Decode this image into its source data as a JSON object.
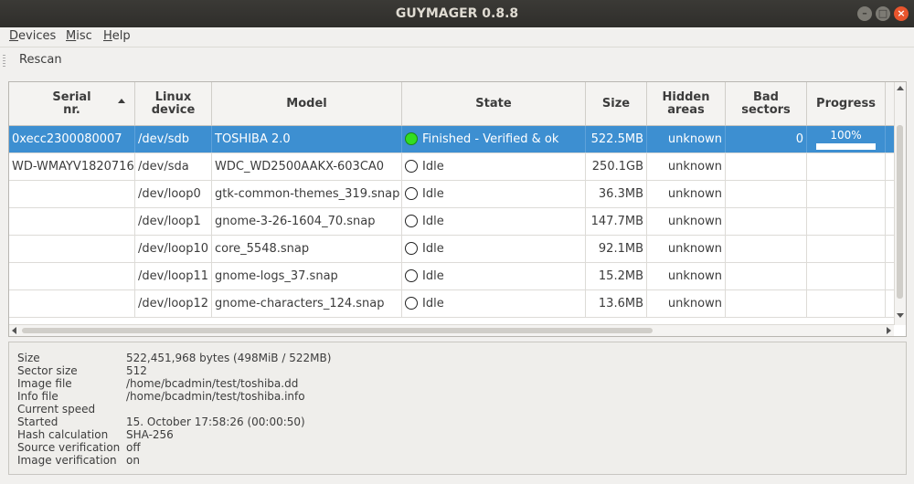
{
  "window": {
    "title": "GUYMAGER 0.8.8"
  },
  "menu": {
    "items": [
      {
        "label": "Devices",
        "ul": "D",
        "rest": "evices"
      },
      {
        "label": "Misc",
        "ul": "M",
        "rest": "isc"
      },
      {
        "label": "Help",
        "ul": "H",
        "rest": "elp"
      }
    ]
  },
  "toolbar": {
    "rescan_label": "Rescan"
  },
  "table": {
    "headers": [
      "Serial\nnr.",
      "Linux\ndevice",
      "Model",
      "State",
      "Size",
      "Hidden\nareas",
      "Bad\nsectors",
      "Progress"
    ],
    "rows": [
      {
        "serial": "0xecc2300080007",
        "device": "/dev/sdb",
        "model": "TOSHIBA 2.0",
        "state": "Finished - Verified & ok",
        "size": "522.5MB",
        "hidden": "unknown",
        "bad": "0",
        "progress": "100%"
      },
      {
        "serial": "WD-WMAYV1820716",
        "device": "/dev/sda",
        "model": "WDC_WD2500AAKX-603CA0",
        "state": "Idle",
        "size": "250.1GB",
        "hidden": "unknown",
        "bad": "",
        "progress": ""
      },
      {
        "serial": "",
        "device": "/dev/loop0",
        "model": "gtk-common-themes_319.snap",
        "state": "Idle",
        "size": "36.3MB",
        "hidden": "unknown",
        "bad": "",
        "progress": ""
      },
      {
        "serial": "",
        "device": "/dev/loop1",
        "model": "gnome-3-26-1604_70.snap",
        "state": "Idle",
        "size": "147.7MB",
        "hidden": "unknown",
        "bad": "",
        "progress": ""
      },
      {
        "serial": "",
        "device": "/dev/loop10",
        "model": "core_5548.snap",
        "state": "Idle",
        "size": "92.1MB",
        "hidden": "unknown",
        "bad": "",
        "progress": ""
      },
      {
        "serial": "",
        "device": "/dev/loop11",
        "model": "gnome-logs_37.snap",
        "state": "Idle",
        "size": "15.2MB",
        "hidden": "unknown",
        "bad": "",
        "progress": ""
      },
      {
        "serial": "",
        "device": "/dev/loop12",
        "model": "gnome-characters_124.snap",
        "state": "Idle",
        "size": "13.6MB",
        "hidden": "unknown",
        "bad": "",
        "progress": ""
      }
    ]
  },
  "info": [
    {
      "k": "Size",
      "v": "522,451,968 bytes (498MiB / 522MB)"
    },
    {
      "k": "Sector size",
      "v": "512"
    },
    {
      "k": "Image file",
      "v": "/home/bcadmin/test/toshiba.dd"
    },
    {
      "k": "Info file",
      "v": "/home/bcadmin/test/toshiba.info"
    },
    {
      "k": "Current speed",
      "v": ""
    },
    {
      "k": "Started",
      "v": "15. October 17:58:26 (00:00:50)"
    },
    {
      "k": "Hash calculation",
      "v": "SHA-256"
    },
    {
      "k": "Source verification",
      "v": "off"
    },
    {
      "k": "Image verification",
      "v": "on"
    }
  ],
  "colors": {
    "selection": "#3d8fd1",
    "titlebar": "#3b3a36",
    "close": "#e9552d",
    "state_ok": "#33dd22"
  },
  "progress_fraction": 1.0
}
